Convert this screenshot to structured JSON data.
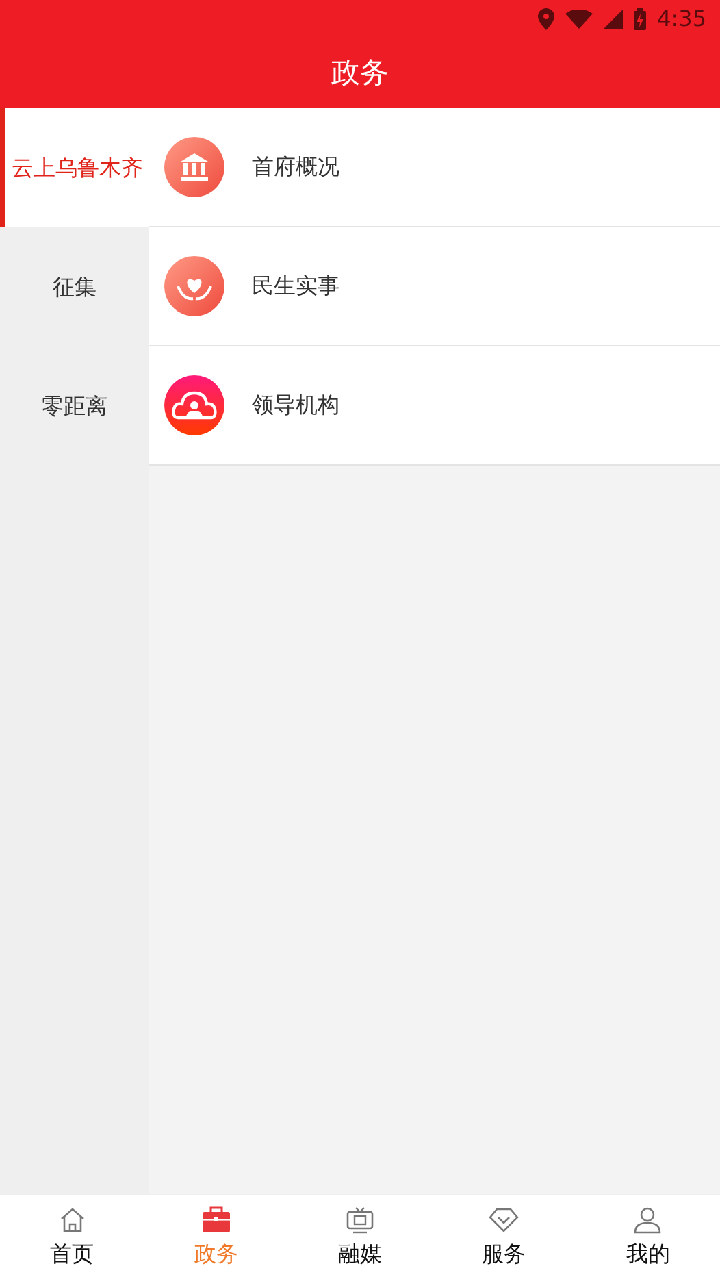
{
  "status_bar": {
    "time": "4:35"
  },
  "header": {
    "title": "政务"
  },
  "sidebar": {
    "items": [
      {
        "label": "云上乌鲁木齐",
        "selected": true
      },
      {
        "label": "征集",
        "selected": false
      },
      {
        "label": "零距离",
        "selected": false
      }
    ]
  },
  "list": {
    "items": [
      {
        "label": "首府概况"
      },
      {
        "label": "民生实事"
      },
      {
        "label": "领导机构"
      }
    ]
  },
  "tab_bar": {
    "tabs": [
      {
        "label": "首页",
        "selected": false
      },
      {
        "label": "政务",
        "selected": true
      },
      {
        "label": "融媒",
        "selected": false
      },
      {
        "label": "服务",
        "selected": false
      },
      {
        "label": "我的",
        "selected": false
      }
    ]
  }
}
